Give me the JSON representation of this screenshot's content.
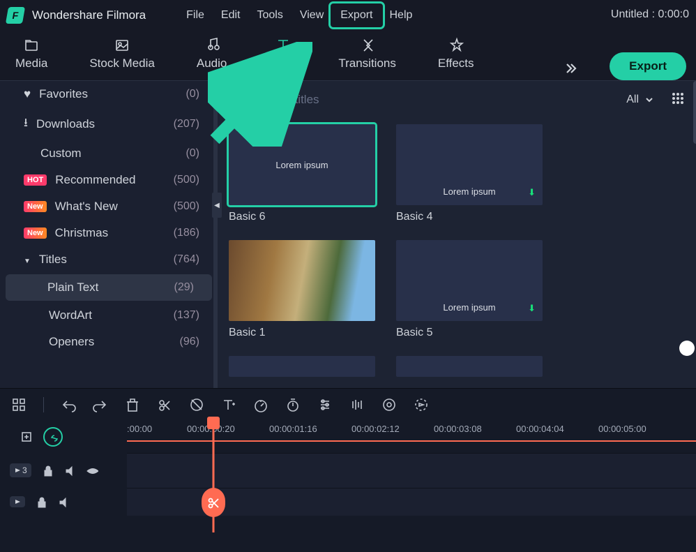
{
  "app": {
    "name": "Wondershare Filmora",
    "title_status": "Untitled : 0:00:0"
  },
  "menu": [
    "File",
    "Edit",
    "Tools",
    "View",
    "Export",
    "Help"
  ],
  "menu_highlight": "Export",
  "tabs": [
    {
      "id": "media",
      "label": "Media"
    },
    {
      "id": "stock",
      "label": "Stock Media"
    },
    {
      "id": "audio",
      "label": "Audio"
    },
    {
      "id": "titles",
      "label": "Titles"
    },
    {
      "id": "transitions",
      "label": "Transitions"
    },
    {
      "id": "effects",
      "label": "Effects"
    }
  ],
  "active_tab": "titles",
  "export_btn": "Export",
  "sidebar": [
    {
      "icon": "heart",
      "label": "Favorites",
      "count": "(0)"
    },
    {
      "icon": "download",
      "label": "Downloads",
      "count": "(207)"
    },
    {
      "icon": "",
      "label": "Custom",
      "count": "(0)",
      "indent": true
    },
    {
      "badge": "HOT",
      "badgecls": "hot",
      "label": "Recommended",
      "count": "(500)"
    },
    {
      "badge": "New",
      "badgecls": "new",
      "label": "What's New",
      "count": "(500)"
    },
    {
      "badge": "New",
      "badgecls": "new",
      "label": "Christmas",
      "count": "(186)"
    },
    {
      "icon": "chev",
      "label": "Titles",
      "count": "(764)"
    },
    {
      "label": "Plain Text",
      "count": "(29)",
      "selected": true
    },
    {
      "label": "WordArt",
      "count": "(137)",
      "sub": true
    },
    {
      "label": "Openers",
      "count": "(96)",
      "sub": true
    }
  ],
  "search": {
    "placeholder": "Search titles"
  },
  "filter": {
    "label": "All"
  },
  "tiles": [
    {
      "label": "Basic 6",
      "thumb_text": "Lorem ipsum",
      "selected": true,
      "centered": true
    },
    {
      "label": "Basic 4",
      "thumb_text": "Lorem ipsum",
      "download": true
    },
    {
      "label": "Basic 1",
      "photo": true
    },
    {
      "label": "Basic 5",
      "thumb_text": "Lorem ipsum",
      "download": true
    }
  ],
  "timeline": {
    "timecodes": [
      ":00:00",
      "00:00:00:20",
      "00:00:01:16",
      "00:00:02:12",
      "00:00:03:08",
      "00:00:04:04",
      "00:00:05:00"
    ],
    "track_number": "3"
  }
}
